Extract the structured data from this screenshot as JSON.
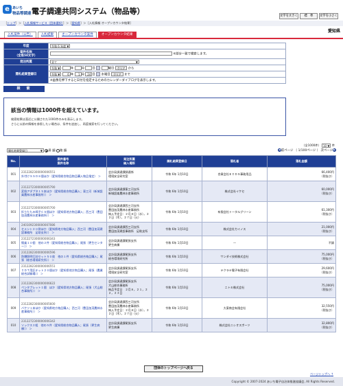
{
  "header": {
    "logo_mark": "e",
    "logo_line1": "あいち",
    "logo_line2": "物品等調達",
    "title": "電子調達共同システム（物品等）",
    "font_buttons": [
      "文字を大きく",
      "標　準",
      "文字を小さく"
    ]
  },
  "breadcrumb": {
    "items": [
      "トップ",
      "入札情報サービス（団体選択）",
      "愛知県"
    ],
    "current": "入札情報 オープンカウンタ結果"
  },
  "org_name": "愛知県",
  "tabs": [
    {
      "label": "入札案件（公告）",
      "active": false
    },
    {
      "label": "入札結果",
      "active": false
    },
    {
      "label": "オープンカウンタ案件",
      "active": false
    },
    {
      "label": "オープンカウンタ結果",
      "active": true
    }
  ],
  "search": {
    "year_label": "年度",
    "year_era": "令和",
    "year_value": "6",
    "year_suffix": "年度",
    "name_label_1": "案件名称",
    "name_label_2": "（全角50文字）",
    "name_value": "",
    "name_hint": "※部分一致で検索します。",
    "dept_label": "発注所属",
    "dept_value": "全て",
    "date_label": "開札結果登録日",
    "from_era": "令和",
    "from_year": "",
    "from_month": "",
    "from_day": "",
    "to_era": "令和",
    "to_year": "6",
    "to_month": "1",
    "to_day": "24",
    "y": "年",
    "m": "月",
    "d": "日",
    "weekday_from": "曜日",
    "weekday_to": "水曜日",
    "clear": "クリア",
    "from_suffix": "から",
    "to_suffix": "まで",
    "cal_note": "※画像を押下すると日付を指定するためのカレンダーダイアログを表示します。",
    "search_button": "検　索"
  },
  "message": {
    "heading": "該当の情報は1000件を超えています。",
    "line1": "検索結果は直近に公開された1000件のみを表示します。",
    "line2": "さらに以前の情報を参照したい場合は、条件を追加し、再度検索を行ってください。"
  },
  "results": {
    "count_text": "（全1000件）",
    "per_page": "10",
    "per_page_suffix": "件",
    "page_info": "（ 1/100ページ ）",
    "next_label": "次ページ",
    "prev_label": "前ページ",
    "sort_field": "開札結果登録日",
    "sort_asc": "昇 順",
    "sort_desc": "降 順",
    "columns": [
      "No.",
      "案件番号",
      "案件名称",
      "発注所属",
      "納入場所",
      "開札結果登録日",
      "落札者",
      "落札金額"
    ],
    "rows": [
      {
        "no": "001",
        "num": "2312282300000006551",
        "name": "外付けＳＳＤ８個ほか（愛知県総合物品物品購入物品指定）",
        "dept": "会計局調達課調達係",
        "place": "環境安全研究室",
        "date": "令和 6年 1月10日",
        "winner": "合資会社ＥＩＤＳ事務用品",
        "amount": "66,400円",
        "tax": "（税抜き）"
      },
      {
        "no": "002",
        "num": "2312272300000005790",
        "name": "変換アダプタ１５本ほか（愛知県総合物品購入；東三河（新城設楽農林水産事務所））",
        "dept": "会計局調達課東三河支所",
        "place": "新城設楽農林水産事務所",
        "date": "令和 6年 1月10日",
        "winner": "株式会社イケセ",
        "amount": "60,000円",
        "tax": "（税抜き）"
      },
      {
        "no": "003",
        "num": "2312272300000005700",
        "name": "折りたたみ椅子ＣＳ個ほか（愛知県地方物品購入；西三河（豊田加茂農林水産事務所））",
        "dept": "会計局調達課西三河支所",
        "place": "豊田加茂農林水産事務所",
        "detail": "納入予定日：２月８日（水），２２日（木），２７日（火）",
        "date": "令和 6年 1月10日",
        "winner": "有限会社トータルグリーン",
        "amount": "61,300円",
        "tax": "（税抜き）"
      },
      {
        "no": "004",
        "num": "2401092300000007086",
        "name": "セメント２０袋ほか（愛知県地方物品購入；西三河（豊田加茂建設事務所　足助支所））",
        "dept": "会計局調達課西三河支所",
        "place": "豊田加茂建設事務所　足助支所",
        "date": "令和 6年 1月10日",
        "winner": "株式会社カイノス",
        "amount": "21,000円",
        "tax": "（税抜き）"
      },
      {
        "no": "005",
        "num": "2312272300000006343",
        "name": "懐楽１０個　他の２件（愛知県総合物品購入；尾張（更生センター））",
        "dept": "会計局調達課尾張支所",
        "place": "更生病棟",
        "date": "令和 6年 1月10日",
        "winner": "—",
        "amount": "不調",
        "tax": ""
      },
      {
        "no": "006",
        "num": "2312282300000006596",
        "name": "防爆照明灯封セット５０枚　他の１件（愛知県総合物品購入；尾張（総合環境研究所））",
        "dept": "会計局調達課尾張支所",
        "place": "総合環境研究所",
        "date": "令和 6年 1月10日",
        "winner": "サンダイ技術株式会社",
        "amount": "75,000円",
        "tax": "（税抜き）"
      },
      {
        "no": "007",
        "num": "2312282300000006551",
        "name": "ＩＤＴ用記キット２０個ほか（愛知県地方物品購入；尾張（農業総合試験場））",
        "dept": "会計局調達課尾張支所",
        "place": "環境安全研究室",
        "date": "令和 6年 1月10日",
        "winner": "テクラテ電子有限会社",
        "amount": "29,600円",
        "tax": "（税抜き）"
      },
      {
        "no": "008",
        "num": "2312282300000006622",
        "name": "ペンタブレット１個　ほか（愛知県地方物品購入；尾張（犬山総合事務所））",
        "dept": "会計局調達課尾張支所",
        "place": "犬山総合事務所",
        "detail": "納品予定日　２月８，２１，２２，２３日",
        "date": "令和 6年 1月10日",
        "winner": "ニトキ株式会社",
        "amount": "75,000円",
        "tax": "（税抜き）"
      },
      {
        "no": "009",
        "num": "2312282300000005600",
        "name": "バケツ１本ほか（愛知県地方物品購入；西三河（豊田加茂農林水産事務所））",
        "dept": "会計局調達課西三河支所",
        "place": "豊田加茂農林水産事務所",
        "detail": "納入予定日：２月８日（水），２２日（木），２７日（火）",
        "date": "令和 6年 1月10日",
        "winner": "大東商会有限会社",
        "amount": "32,550円",
        "tax": "（税抜き）"
      },
      {
        "no": "010",
        "num": "2312272300000006342",
        "name": "ソックス２組　他の５件（愛知県総合物品購入；尾張（更生病棟））",
        "dept": "会計局調達課尾張支所",
        "place": "更生病棟",
        "date": "令和 6年 1月10日",
        "winner": "株式会社ニシオスポーツ",
        "amount": "32,800円",
        "tax": "（税抜き）"
      }
    ]
  },
  "top_button": "団体のトップページへ戻る",
  "page_top": "ページトップへ",
  "footer": "Copyright © 2007-2024 あいち電子自治体推進協議会, All Rights Reserved."
}
